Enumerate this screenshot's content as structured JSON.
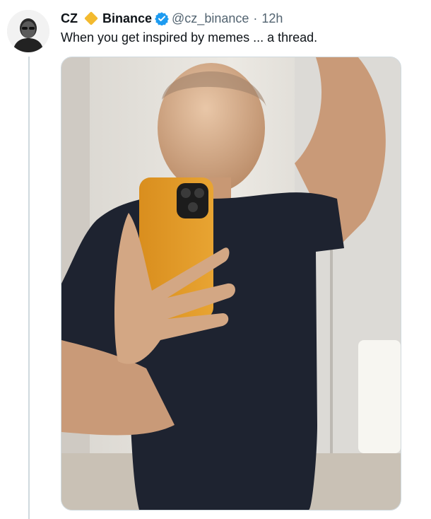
{
  "tweet": {
    "author_name": "CZ",
    "org_name": "Binance",
    "handle": "@cz_binance",
    "separator": "·",
    "time": "12h",
    "text": "When you get inspired by memes ... a thread."
  },
  "icons": {
    "brand_badge": "diamond-icon",
    "verified": "verified-icon"
  },
  "colors": {
    "verified": "#1d9bf0",
    "brand_badge": "#f3ba2f",
    "secondary_text": "#536471"
  }
}
